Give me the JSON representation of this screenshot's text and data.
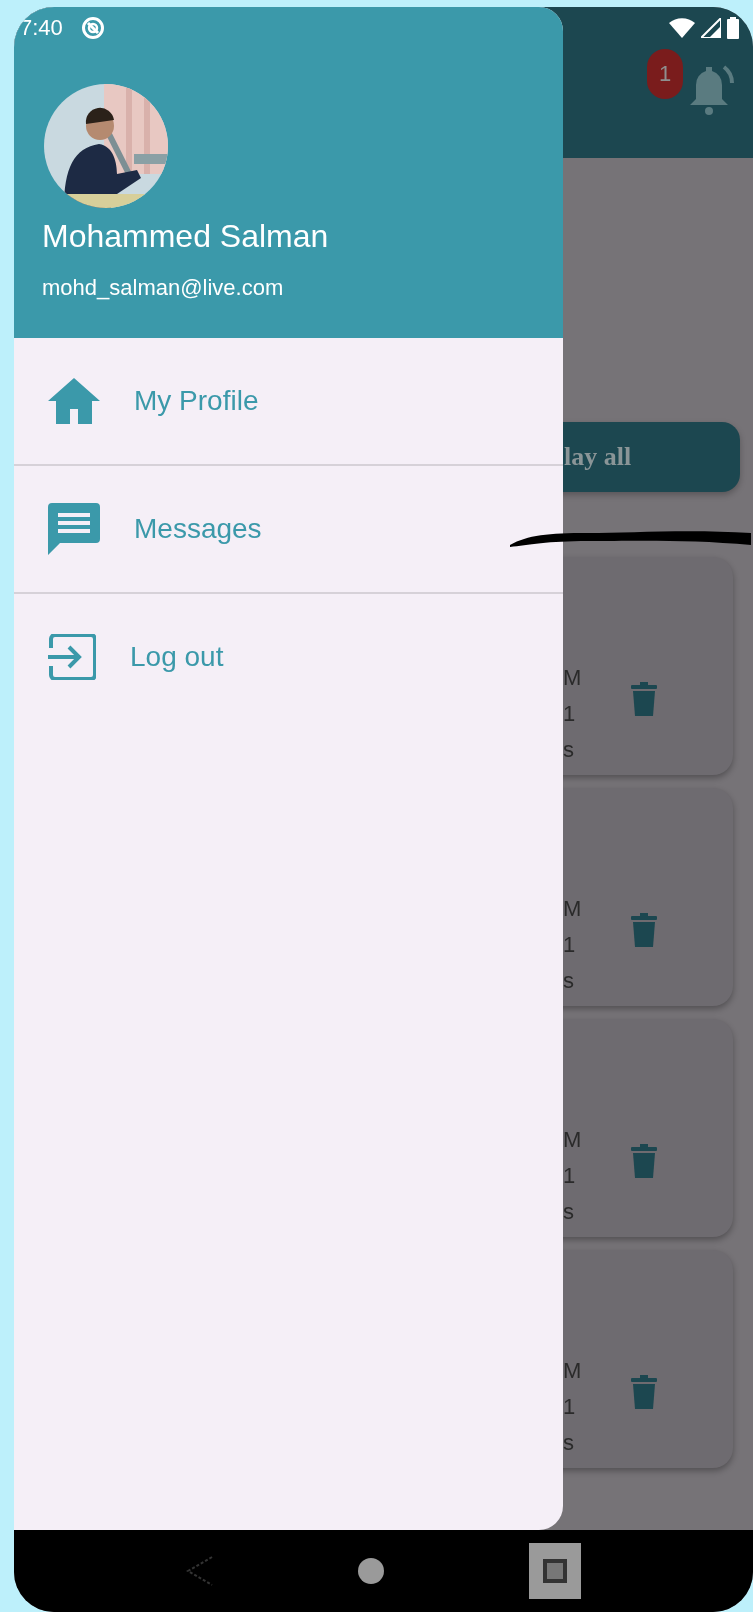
{
  "status_bar": {
    "time": "7:40"
  },
  "app_bar": {
    "notification_count": "1"
  },
  "background": {
    "button": "lay all",
    "cards": [
      {
        "lines": [
          "M",
          "1",
          "s"
        ]
      },
      {
        "lines": [
          "M",
          "1",
          "s"
        ]
      },
      {
        "lines": [
          "M",
          "1",
          "s"
        ]
      },
      {
        "lines": [
          "M",
          "1",
          "s"
        ]
      }
    ]
  },
  "drawer": {
    "name": "Mohammed Salman",
    "email": "mohd_salman@live.com",
    "items": [
      {
        "label": "My Profile",
        "kind": "home"
      },
      {
        "label": "Messages",
        "kind": "message"
      },
      {
        "label": "Log out",
        "kind": "logout"
      }
    ]
  }
}
